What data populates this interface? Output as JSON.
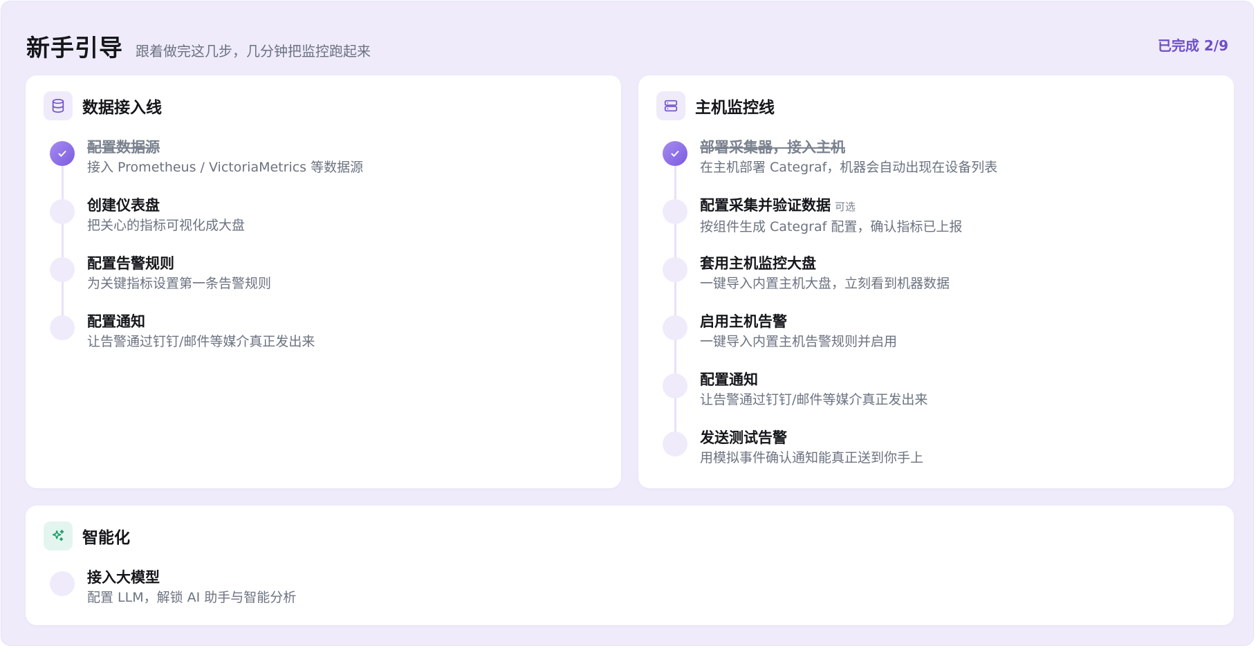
{
  "header": {
    "title": "新手引导",
    "subtitle": "跟着做完这几步，几分钟把监控跑起来",
    "progress": "已完成 2/9"
  },
  "colors": {
    "accent": "#6e4fc7",
    "done_dot": "#8a6ae6",
    "pending_dot": "#efebfb",
    "ai_icon": "#1f9d6a"
  },
  "cards": {
    "data": {
      "icon": "database-icon",
      "title": "数据接入线",
      "steps": [
        {
          "title": "配置数据源",
          "desc": "接入 Prometheus / VictoriaMetrics 等数据源",
          "done": true
        },
        {
          "title": "创建仪表盘",
          "desc": "把关心的指标可视化成大盘",
          "done": false
        },
        {
          "title": "配置告警规则",
          "desc": "为关键指标设置第一条告警规则",
          "done": false
        },
        {
          "title": "配置通知",
          "desc": "让告警通过钉钉/邮件等媒介真正发出来",
          "done": false
        }
      ]
    },
    "host": {
      "icon": "server-icon",
      "title": "主机监控线",
      "steps": [
        {
          "title": "部署采集器，接入主机",
          "desc": "在主机部署 Categraf，机器会自动出现在设备列表",
          "done": true
        },
        {
          "title": "配置采集并验证数据",
          "tag": "可选",
          "desc": "按组件生成 Categraf 配置，确认指标已上报",
          "done": false
        },
        {
          "title": "套用主机监控大盘",
          "desc": "一键导入内置主机大盘，立刻看到机器数据",
          "done": false
        },
        {
          "title": "启用主机告警",
          "desc": "一键导入内置主机告警规则并启用",
          "done": false
        },
        {
          "title": "配置通知",
          "desc": "让告警通过钉钉/邮件等媒介真正发出来",
          "done": false
        },
        {
          "title": "发送测试告警",
          "desc": "用模拟事件确认通知能真正送到你手上",
          "done": false
        }
      ]
    },
    "ai": {
      "icon": "sparkles-icon",
      "title": "智能化",
      "steps": [
        {
          "title": "接入大模型",
          "desc": "配置 LLM，解锁 AI 助手与智能分析",
          "done": false
        }
      ]
    }
  }
}
